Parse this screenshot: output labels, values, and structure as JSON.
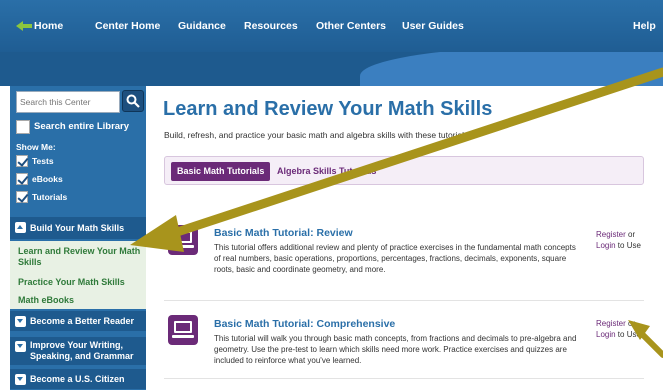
{
  "nav": {
    "items": [
      "Home",
      "Center Home",
      "Guidance",
      "Resources",
      "Other Centers",
      "User Guides",
      "Help"
    ]
  },
  "sidebar": {
    "search_placeholder": "Search this Center",
    "search_library_label": "Search entire Library",
    "show_me_label": "Show Me:",
    "filters": [
      {
        "label": "Tests",
        "checked": true
      },
      {
        "label": "eBooks",
        "checked": true
      },
      {
        "label": "Tutorials",
        "checked": true
      }
    ],
    "section_build": "Build Your Math Skills",
    "subitems": [
      "Learn and Review Your Math Skills",
      "Practice Your Math Skills",
      "Math eBooks"
    ],
    "section_reader": "Become a Better Reader",
    "section_writing": "Improve Your Writing, Speaking, and Grammar",
    "section_citizen": "Become a U.S. Citizen"
  },
  "main": {
    "title": "Learn and Review Your Math Skills",
    "intro": "Build, refresh, and practice your basic math and algebra skills with these tutorials.",
    "tabs": [
      {
        "label": "Basic Math Tutorials",
        "active": true
      },
      {
        "label": "Algebra Skills Tutorials",
        "active": false
      }
    ],
    "courses": [
      {
        "title": "Basic Math Tutorial: Review",
        "description": "This tutorial offers additional review and plenty of practice exercises in the fundamental math concepts of real numbers, basic operations, proportions, percentages, fractions, decimals, exponents, square roots, basic and coordinate geometry, and more.",
        "register": "Register",
        "or": " or",
        "login": "Login",
        "to_use": " to Use"
      },
      {
        "title": "Basic Math Tutorial: Comprehensive",
        "description": "This tutorial will walk you through basic math concepts, from fractions and decimals to pre-algebra and geometry. Use the pre-test to learn which skills need more work. Practice exercises and quizzes are included to reinforce what you've learned.",
        "register": "Register",
        "or": " or",
        "login": "Login",
        "to_use": " to Use"
      }
    ]
  },
  "colors": {
    "nav_blue": "#2a6fa8",
    "accent_purple": "#6b2a78",
    "annotation_gold": "#a8941c",
    "subnav_green": "#2f7a3a"
  }
}
